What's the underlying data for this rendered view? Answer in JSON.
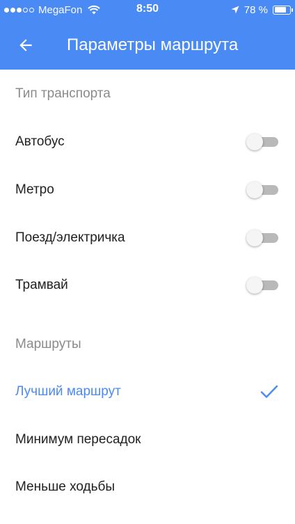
{
  "status_bar": {
    "carrier": "MegaFon",
    "time": "8:50",
    "battery_percent": "78 %",
    "battery_level": 0.78,
    "signal_bars_filled": 3,
    "signal_bars_total": 5
  },
  "app_bar": {
    "title": "Параметры маршрута",
    "back_icon": "arrow-left-icon"
  },
  "transport": {
    "header": "Тип транспорта",
    "items": [
      {
        "label": "Автобус",
        "enabled": false
      },
      {
        "label": "Метро",
        "enabled": false
      },
      {
        "label": "Поезд/электричка",
        "enabled": false
      },
      {
        "label": "Трамвай",
        "enabled": false
      }
    ]
  },
  "routes": {
    "header": "Маршруты",
    "items": [
      {
        "label": "Лучший маршрут",
        "selected": true
      },
      {
        "label": "Минимум пересадок",
        "selected": false
      },
      {
        "label": "Меньше ходьбы",
        "selected": false
      }
    ]
  },
  "colors": {
    "accent": "#4a8af4",
    "header_text": "#ffffff",
    "section_header": "#8a8a8a",
    "text": "#212121"
  }
}
